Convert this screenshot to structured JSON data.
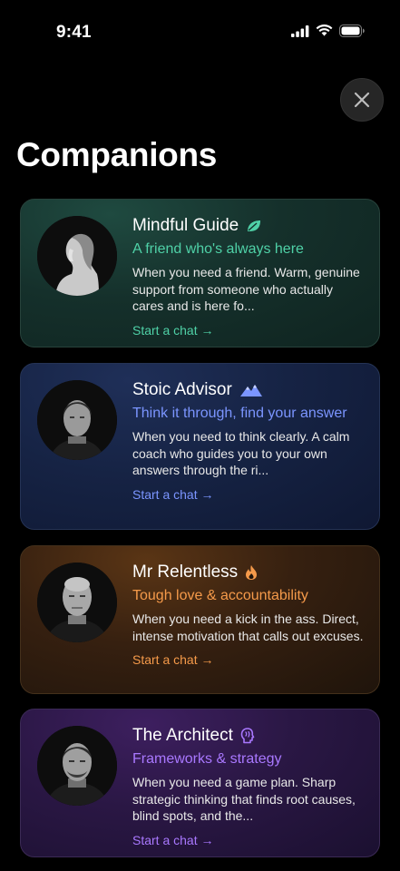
{
  "status": {
    "time": "9:41"
  },
  "header": {
    "title": "Companions"
  },
  "companions": [
    {
      "name": "Mindful Guide",
      "icon": "leaf-icon",
      "tagline": "A friend who's always here",
      "description": "When you need a friend. Warm, genuine support from someone who actually cares and is here fo...",
      "cta": "Start a chat →",
      "accent": "#4fd1a7"
    },
    {
      "name": "Stoic Advisor",
      "icon": "mountain-icon",
      "tagline": "Think it through, find your answer",
      "description": "When you need to think clearly. A calm coach who guides you to your own answers through the ri...",
      "cta": "Start a chat →",
      "accent": "#7b95ff"
    },
    {
      "name": "Mr Relentless",
      "icon": "flame-icon",
      "tagline": "Tough love & accountability",
      "description": "When you need a kick in the ass. Direct, intense motivation that calls out excuses.",
      "cta": "Start a chat →",
      "accent": "#f59a4a"
    },
    {
      "name": "The Architect",
      "icon": "brain-icon",
      "tagline": "Frameworks & strategy",
      "description": "When you need a game plan. Sharp strategic thinking that finds root causes, blind spots, and the...",
      "cta": "Start a chat →",
      "accent": "#a978ff"
    }
  ]
}
